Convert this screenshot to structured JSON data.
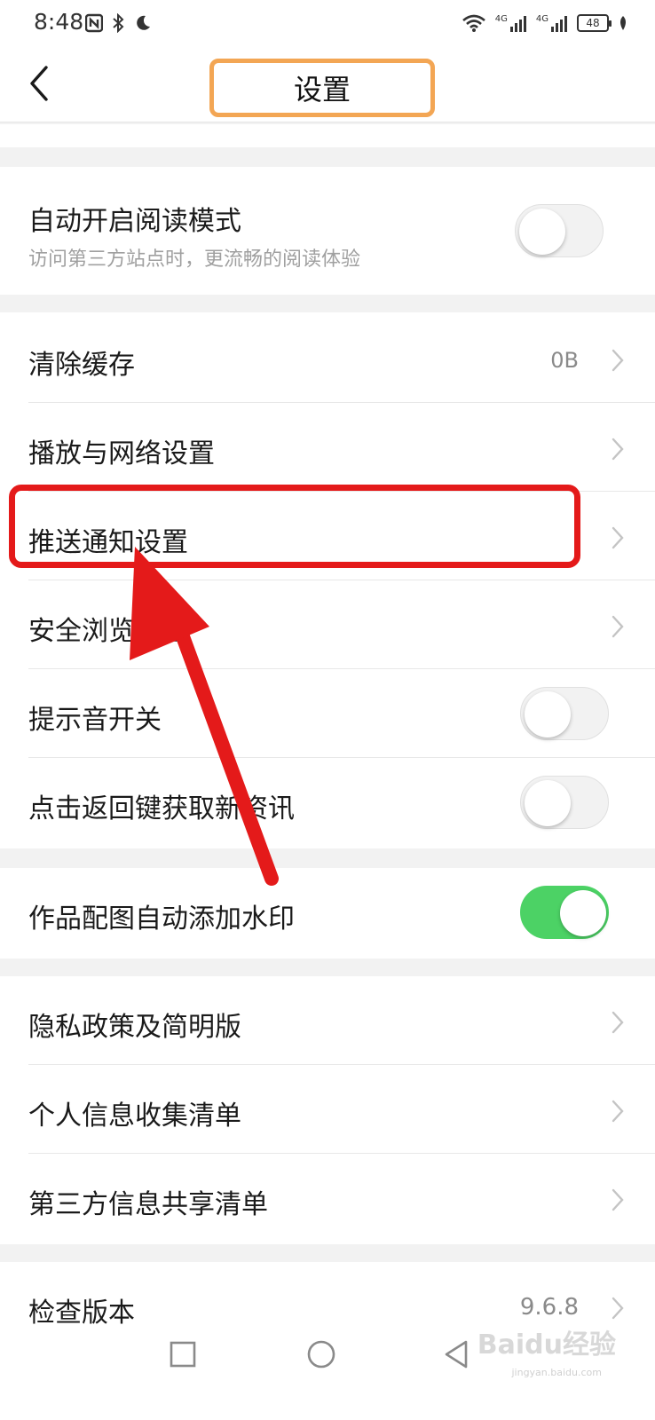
{
  "status_bar": {
    "time": "8:48",
    "left_icons": [
      "nfc-icon",
      "bluetooth-icon",
      "moon-icon"
    ],
    "signal_1": "4G",
    "signal_2": "4G",
    "battery": "48"
  },
  "header": {
    "back_icon": "chevron-left-icon",
    "title": "设置"
  },
  "reading_mode": {
    "label": "自动开启阅读模式",
    "description": "访问第三方站点时，更流畅的阅读体验",
    "enabled": false
  },
  "group_general": [
    {
      "label": "清除缓存",
      "value": "0B",
      "type": "nav"
    },
    {
      "label": "播放与网络设置",
      "type": "nav"
    },
    {
      "label": "推送通知设置",
      "type": "nav"
    },
    {
      "label": "安全浏览设置",
      "type": "nav"
    },
    {
      "label": "提示音开关",
      "type": "toggle",
      "enabled": false
    },
    {
      "label": "点击返回键获取新资讯",
      "type": "toggle",
      "enabled": false
    }
  ],
  "watermark_toggle": {
    "label": "作品配图自动添加水印",
    "enabled": true
  },
  "group_privacy": [
    {
      "label": "隐私政策及简明版",
      "type": "nav"
    },
    {
      "label": "个人信息收集清单",
      "type": "nav"
    },
    {
      "label": "第三方信息共享清单",
      "type": "nav"
    }
  ],
  "version": {
    "label": "检查版本",
    "value": "9.6.8"
  },
  "nav": {
    "recent_icon": "square-icon",
    "home_icon": "circle-icon",
    "back_icon": "triangle-back-icon"
  },
  "colors": {
    "highlight_orange": "#f3a654",
    "highlight_red": "#e41a1a",
    "toggle_on": "#4cd265"
  },
  "watermark": {
    "brand": "Baidu经验",
    "url": "jingyan.baidu.com"
  }
}
